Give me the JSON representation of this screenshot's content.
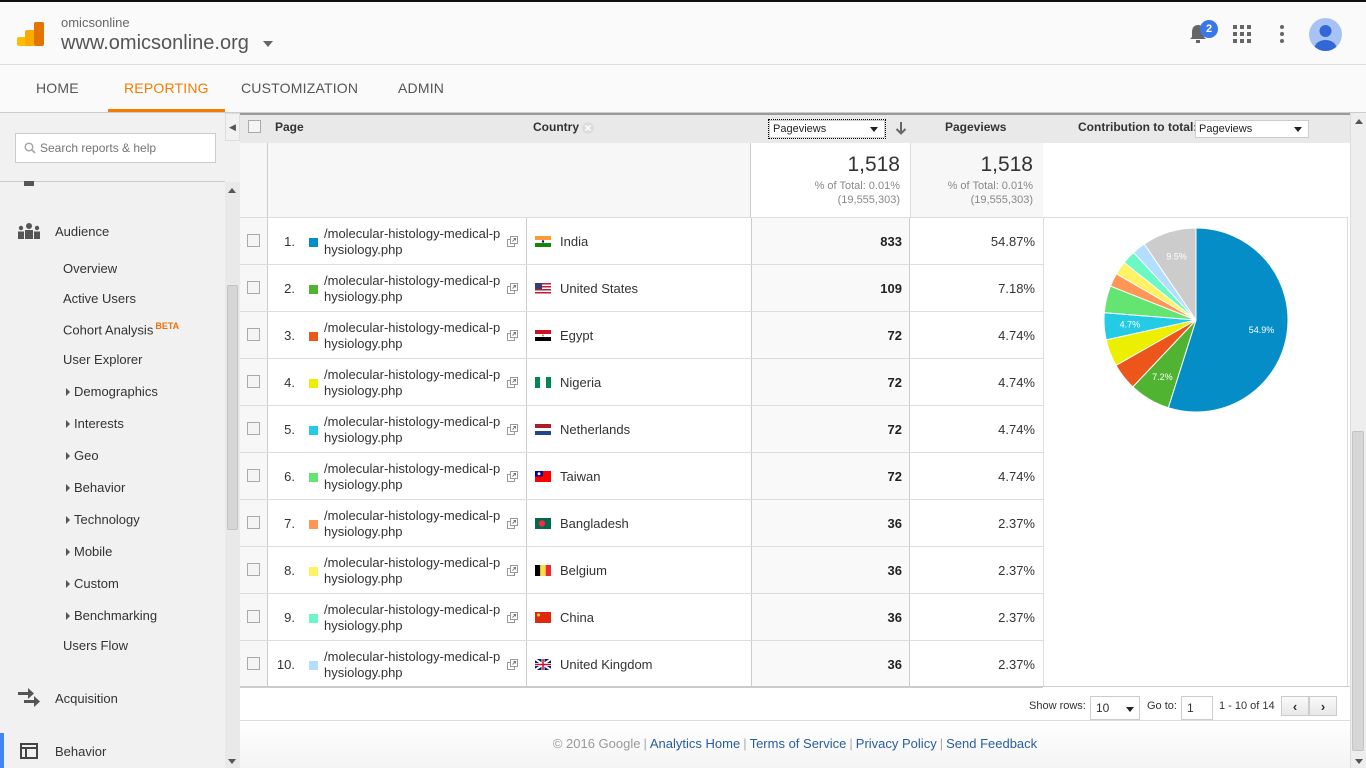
{
  "header": {
    "account": "omicsonline",
    "property": "www.omicsonline.org",
    "notification_count": "2"
  },
  "nav": {
    "tabs": [
      {
        "label": "HOME"
      },
      {
        "label": "REPORTING",
        "active": true
      },
      {
        "label": "CUSTOMIZATION"
      },
      {
        "label": "ADMIN"
      }
    ]
  },
  "sidebar": {
    "search_placeholder": "Search reports & help",
    "audience": {
      "label": "Audience",
      "items": [
        "Overview",
        "Active Users",
        "Cohort Analysis",
        "User Explorer"
      ],
      "beta_badge": "BETA",
      "expandable": [
        "Demographics",
        "Interests",
        "Geo",
        "Behavior",
        "Technology",
        "Mobile",
        "Custom",
        "Benchmarking"
      ],
      "users_flow": "Users Flow"
    },
    "acquisition": "Acquisition",
    "behavior": "Behavior"
  },
  "table": {
    "headers": {
      "page": "Page",
      "country": "Country",
      "metric_select": "Pageviews",
      "pageviews": "Pageviews",
      "contribution_label": "Contribution to total:",
      "contribution_select": "Pageviews"
    },
    "totals": {
      "value1": "1,518",
      "pct1": "% of Total: 0.01%",
      "abs1": "(19,555,303)",
      "value2": "1,518",
      "pct2": "% of Total: 0.01%",
      "abs2": "(19,555,303)"
    },
    "rows": [
      {
        "rank": "1.",
        "page_line1": "/molecular-histology-medical-p",
        "page_line2": "hysiology.php",
        "country": "India",
        "pageviews": "833",
        "pct": "54.87%",
        "color": "#058dc7"
      },
      {
        "rank": "2.",
        "page_line1": "/molecular-histology-medical-p",
        "page_line2": "hysiology.php",
        "country": "United States",
        "pageviews": "109",
        "pct": "7.18%",
        "color": "#50b432"
      },
      {
        "rank": "3.",
        "page_line1": "/molecular-histology-medical-p",
        "page_line2": "hysiology.php",
        "country": "Egypt",
        "pageviews": "72",
        "pct": "4.74%",
        "color": "#ed561b"
      },
      {
        "rank": "4.",
        "page_line1": "/molecular-histology-medical-p",
        "page_line2": "hysiology.php",
        "country": "Nigeria",
        "pageviews": "72",
        "pct": "4.74%",
        "color": "#edef00"
      },
      {
        "rank": "5.",
        "page_line1": "/molecular-histology-medical-p",
        "page_line2": "hysiology.php",
        "country": "Netherlands",
        "pageviews": "72",
        "pct": "4.74%",
        "color": "#24cbe5"
      },
      {
        "rank": "6.",
        "page_line1": "/molecular-histology-medical-p",
        "page_line2": "hysiology.php",
        "country": "Taiwan",
        "pageviews": "72",
        "pct": "4.74%",
        "color": "#64e572"
      },
      {
        "rank": "7.",
        "page_line1": "/molecular-histology-medical-p",
        "page_line2": "hysiology.php",
        "country": "Bangladesh",
        "pageviews": "36",
        "pct": "2.37%",
        "color": "#ff9655"
      },
      {
        "rank": "8.",
        "page_line1": "/molecular-histology-medical-p",
        "page_line2": "hysiology.php",
        "country": "Belgium",
        "pageviews": "36",
        "pct": "2.37%",
        "color": "#fff263"
      },
      {
        "rank": "9.",
        "page_line1": "/molecular-histology-medical-p",
        "page_line2": "hysiology.php",
        "country": "China",
        "pageviews": "36",
        "pct": "2.37%",
        "color": "#6af9c4"
      },
      {
        "rank": "10.",
        "page_line1": "/molecular-histology-medical-p",
        "page_line2": "hysiology.php",
        "country": "United Kingdom",
        "pageviews": "36",
        "pct": "2.37%",
        "color": "#b2deff"
      }
    ]
  },
  "chart_data": {
    "type": "pie",
    "title": "Contribution to total: Pageviews",
    "categories": [
      "India",
      "United States",
      "Egypt",
      "Nigeria",
      "Netherlands",
      "Taiwan",
      "Bangladesh",
      "Belgium",
      "China",
      "United Kingdom",
      "Other"
    ],
    "values": [
      54.87,
      7.18,
      4.74,
      4.74,
      4.74,
      4.74,
      2.37,
      2.37,
      2.37,
      2.37,
      9.51
    ],
    "colors": [
      "#058dc7",
      "#50b432",
      "#ed561b",
      "#edef00",
      "#24cbe5",
      "#64e572",
      "#ff9655",
      "#fff263",
      "#6af9c4",
      "#b2deff",
      "#cccccc"
    ],
    "data_labels": [
      "54.9%",
      "7.2%",
      "",
      "",
      "4.7%",
      "",
      "",
      "",
      "",
      "",
      "9.5%"
    ]
  },
  "pagination": {
    "show_rows_label": "Show rows:",
    "show_rows_value": "10",
    "goto_label": "Go to:",
    "goto_value": "1",
    "range": "1 - 10 of 14"
  },
  "footer": {
    "copyright": "© 2016 Google",
    "links": [
      "Analytics Home",
      "Terms of Service",
      "Privacy Policy",
      "Send Feedback"
    ]
  }
}
